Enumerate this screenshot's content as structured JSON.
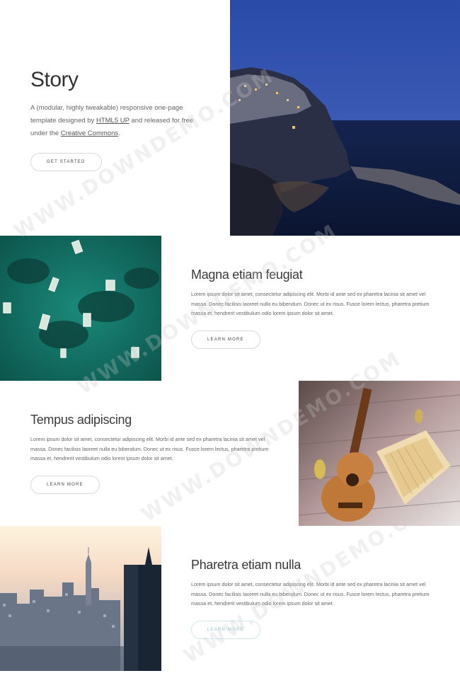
{
  "hero": {
    "title": "Story",
    "intro_pre": "A (modular, highly tweakable) responsive one-page template designed by",
    "intro_link1": "HTML5 UP",
    "intro_mid": "and released for free under the",
    "intro_link2": "Creative Commons",
    "intro_end": ".",
    "button": "GET STARTED"
  },
  "sections": [
    {
      "title": "Magna etiam feugiat",
      "body": "Lorem ipsum dolor sit amet, consectetur adipiscing elit. Morbi id ante sed ex pharetra lacinia sit amet vel massa. Donec facilisis laoreet nulla eu bibendum. Donec ut ex risus. Fusce lorem lectus, pharetra pretium massa et, hendrerit vestibulum odio lorem ipsum dolor sit amet.",
      "button": "LEARN MORE"
    },
    {
      "title": "Tempus adipiscing",
      "body": "Lorem ipsum dolor sit amet, consectetur adipiscing elit. Morbi id ante sed ex pharetra lacinia sit amet vel massa. Donec facilisis laoreet nulla eu bibendum. Donec ut ex risus. Fusce lorem lectus, pharetra pretium massa et, hendrerit vestibulum odio lorem ipsum dolor sit amet.",
      "button": "LEARN MORE"
    },
    {
      "title": "Pharetra etiam nulla",
      "body": "Lorem ipsum dolor sit amet, consectetur adipiscing elit. Morbi id ante sed ex pharetra lacinia sit amet vel massa. Donec facilisis laoreet nulla eu bibendum. Donec ut ex risus. Fusce lorem lectus, pharetra pretium massa et, hendrerit vestibulum odio lorem ipsum dolor sit amet.",
      "button": "LEARN MORE"
    }
  ],
  "watermark": [
    "WWW.DOWNDEMO.COM",
    "WWW.DOWNDEMO.COM",
    "WWW.DOWNDEMO.COM",
    "WWW.DOWNDEMO.COM"
  ],
  "images": [
    "cliff-village-night-photo",
    "aerial-boats-photo",
    "ukulele-book-photo",
    "city-skyline-photo"
  ]
}
